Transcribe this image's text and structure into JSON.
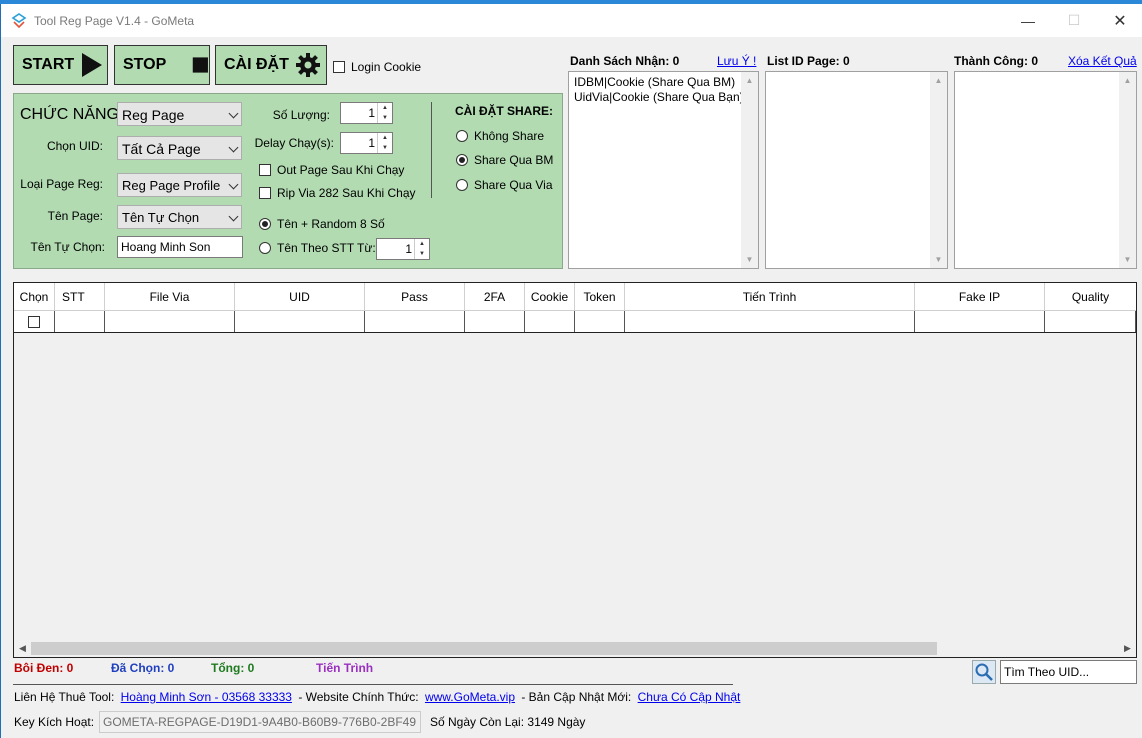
{
  "window": {
    "title": "Tool Reg Page V1.4 - GoMeta"
  },
  "toolbar": {
    "start_label": "START",
    "stop_label": "STOP",
    "settings_label": "CÀI ĐẶT",
    "login_cookie_label": "Login Cookie"
  },
  "config": {
    "function_label": "CHỨC NĂNG:",
    "function_value": "Reg Page",
    "uid_label": "Chọn UID:",
    "uid_value": "Tất Cả Page",
    "page_type_label": "Loại Page Reg:",
    "page_type_value": "Reg Page Profile",
    "page_name_label": "Tên Page:",
    "page_name_value": "Tên Tự Chọn",
    "custom_name_label": "Tên Tự Chọn:",
    "custom_name_value": "Hoang Minh Son",
    "quantity_label": "Số Lượng:",
    "quantity_value": "1",
    "delay_label": "Delay Chạy(s):",
    "delay_value": "1",
    "out_page_label": "Out Page Sau Khi Chạy",
    "rip_via_label": "Rip Via 282 Sau Khi Chạy",
    "name_random_label": "Tên + Random 8 Số",
    "name_stt_label": "Tên Theo STT Từ:",
    "name_stt_value": "1"
  },
  "share": {
    "heading": "CÀI ĐẶT SHARE:",
    "none_label": "Không Share",
    "bm_label": "Share Qua BM",
    "via_label": "Share Qua Via"
  },
  "receive_list": {
    "heading": "Danh Sách Nhận: 0",
    "note_link": "Lưu Ý !",
    "items": [
      "IDBM|Cookie (Share Qua BM)",
      "UidVia|Cookie (Share Qua Bạn)"
    ]
  },
  "page_list": {
    "heading": "List ID Page: 0"
  },
  "success_list": {
    "heading": "Thành Công: 0",
    "clear_link": "Xóa Kết Quả"
  },
  "table": {
    "columns": [
      "Chọn",
      "STT",
      "File Via",
      "UID",
      "Pass",
      "2FA",
      "Cookie",
      "Token",
      "Tiến Trình",
      "Fake IP",
      "Quality"
    ]
  },
  "status": {
    "highlighted": "Bôi Đen: 0",
    "selected": "Đã Chọn: 0",
    "total": "Tổng: 0",
    "progress": "Tiến Trình",
    "highlighted_color": "#c00000",
    "selected_color": "#1f3fbf",
    "total_color": "#1e7a1e",
    "progress_color": "#9a2fc0"
  },
  "search": {
    "placeholder": "Tìm Theo UID..."
  },
  "footer": {
    "contact_label": "Liên Hệ Thuê Tool:",
    "contact_link": "Hoàng Minh Sơn - 03568 33333",
    "website_label": "- Website Chính Thức:",
    "website_link": "www.GoMeta.vip",
    "update_label": "- Bản Cập Nhật Mới:",
    "update_link": "Chưa Có Cập Nhật",
    "key_label": "Key Kích Hoạt:",
    "key_value": "GOMETA-REGPAGE-D19D1-9A4B0-B60B9-776B0-2BF49",
    "days_left": "Số Ngày Còn Lại: 3149 Ngày"
  }
}
